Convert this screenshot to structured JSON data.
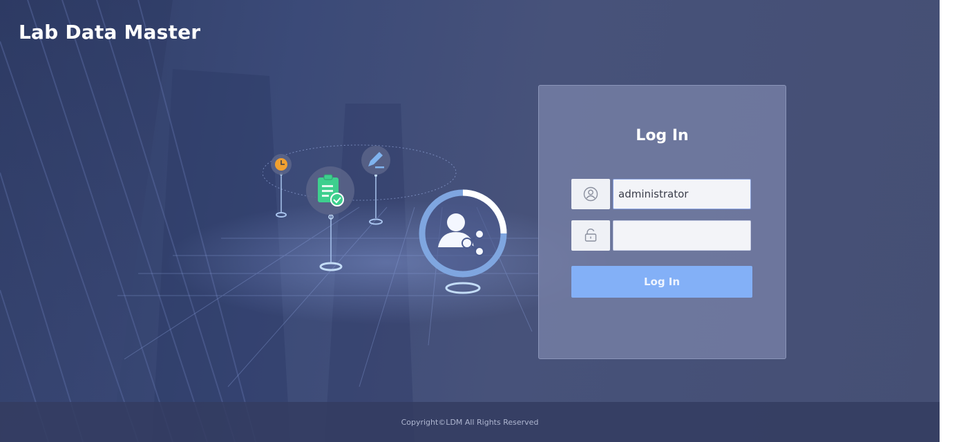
{
  "app": {
    "title": "Lab Data Master"
  },
  "login": {
    "heading": "Log In",
    "username": {
      "value": "administrator",
      "placeholder": "",
      "icon": "user-icon"
    },
    "password": {
      "value": "",
      "placeholder": "",
      "icon": "lock-icon"
    },
    "submit_label": "Log In"
  },
  "footer": {
    "copyright": "Copyright©LDM All Rights Reserved"
  },
  "colors": {
    "background": "#3b4a78",
    "panel": "#7882a8",
    "button": "#83b0f7",
    "accent_green": "#3ecf8e",
    "accent_orange": "#f0a030",
    "accent_blue": "#6f9ad8"
  }
}
